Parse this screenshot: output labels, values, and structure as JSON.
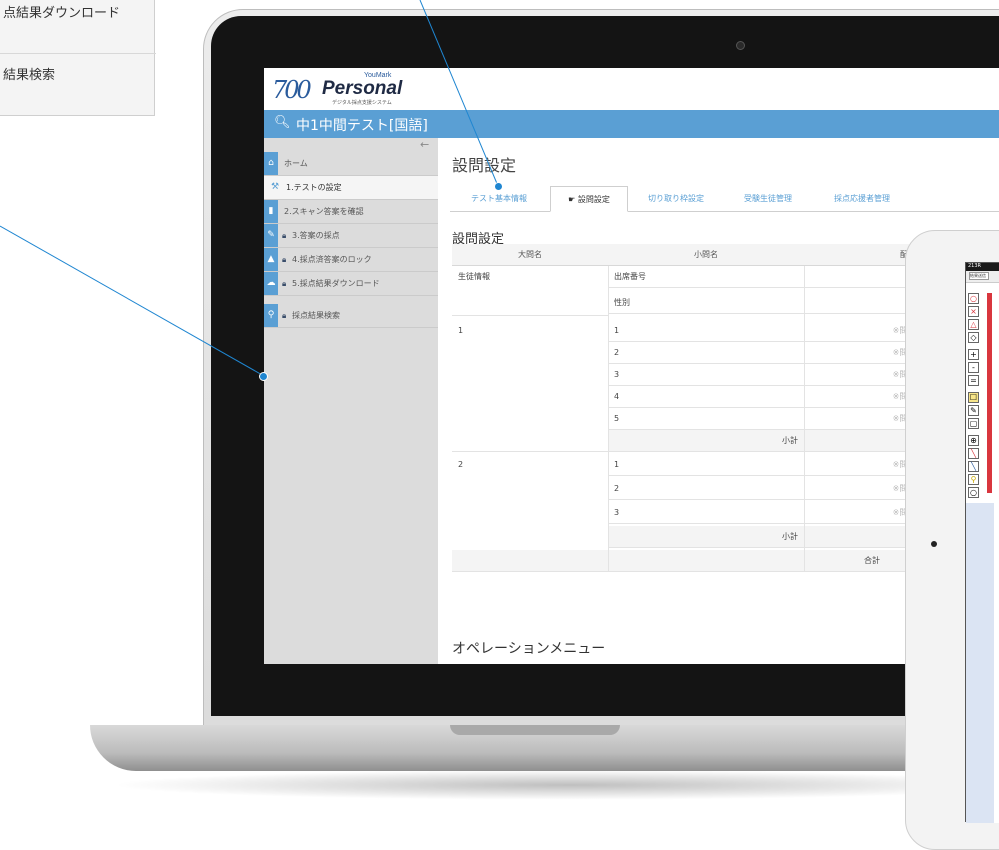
{
  "callout": {
    "items": [
      "点結果ダウンロード",
      "結果検索"
    ]
  },
  "app": {
    "logo_mark": "700",
    "logo_text": "Personal",
    "logo_sup": "YouMark",
    "logo_sub": "デジタル採点支援システム",
    "test_title": "中1中間テスト[国語]",
    "search_icon": "search-icon"
  },
  "sidebar": {
    "items": [
      {
        "label": "ホーム",
        "icon": "home-icon",
        "locked": false
      },
      {
        "label": "1.テストの設定",
        "icon": "wrench-icon",
        "locked": false,
        "active": true
      },
      {
        "label": "2.スキャン答案を確認",
        "icon": "document-icon",
        "locked": false
      },
      {
        "label": "3.答案の採点",
        "icon": "edit-icon",
        "locked": true
      },
      {
        "label": "4.採点済答案のロック",
        "icon": "lock-icon",
        "locked": true
      },
      {
        "label": "5.採点結果ダウンロード",
        "icon": "cloud-download-icon",
        "locked": true
      },
      {
        "label": "採点結果検索",
        "icon": "search-icon",
        "locked": true
      }
    ]
  },
  "main": {
    "page_title": "設問設定",
    "tabs": [
      "テスト基本情報",
      "設問設定",
      "切り取り枠設定",
      "受験生徒管理",
      "採点応援者管理"
    ],
    "active_tab_index": 1,
    "section_title": "設問設定",
    "table": {
      "headers": [
        "大問名",
        "小問名",
        "配点"
      ],
      "student_info_label": "生徒情報",
      "student_info_rows": [
        "出席番号",
        "性別"
      ],
      "groups": [
        {
          "name": "1",
          "subs": [
            "1",
            "2",
            "3",
            "4",
            "5"
          ]
        },
        {
          "name": "2",
          "subs": [
            "1",
            "2",
            "3"
          ]
        }
      ],
      "placeholder": "※問設問",
      "subtotal_label": "小計",
      "total_label": "合計"
    },
    "operation_menu": "オペレーションメニュー"
  },
  "tablet": {
    "title": "213R",
    "button": "結果送信",
    "tools": [
      "○",
      "×",
      "△",
      "◇",
      "+",
      "-",
      "=",
      "☐",
      "✎",
      "▢",
      "⊕",
      "╲",
      "╲",
      "⚲",
      "○"
    ]
  },
  "colors": {
    "accent": "#5a9fd4",
    "callout_dot": "#1f86d1",
    "tablet_red": "#d9363e"
  }
}
